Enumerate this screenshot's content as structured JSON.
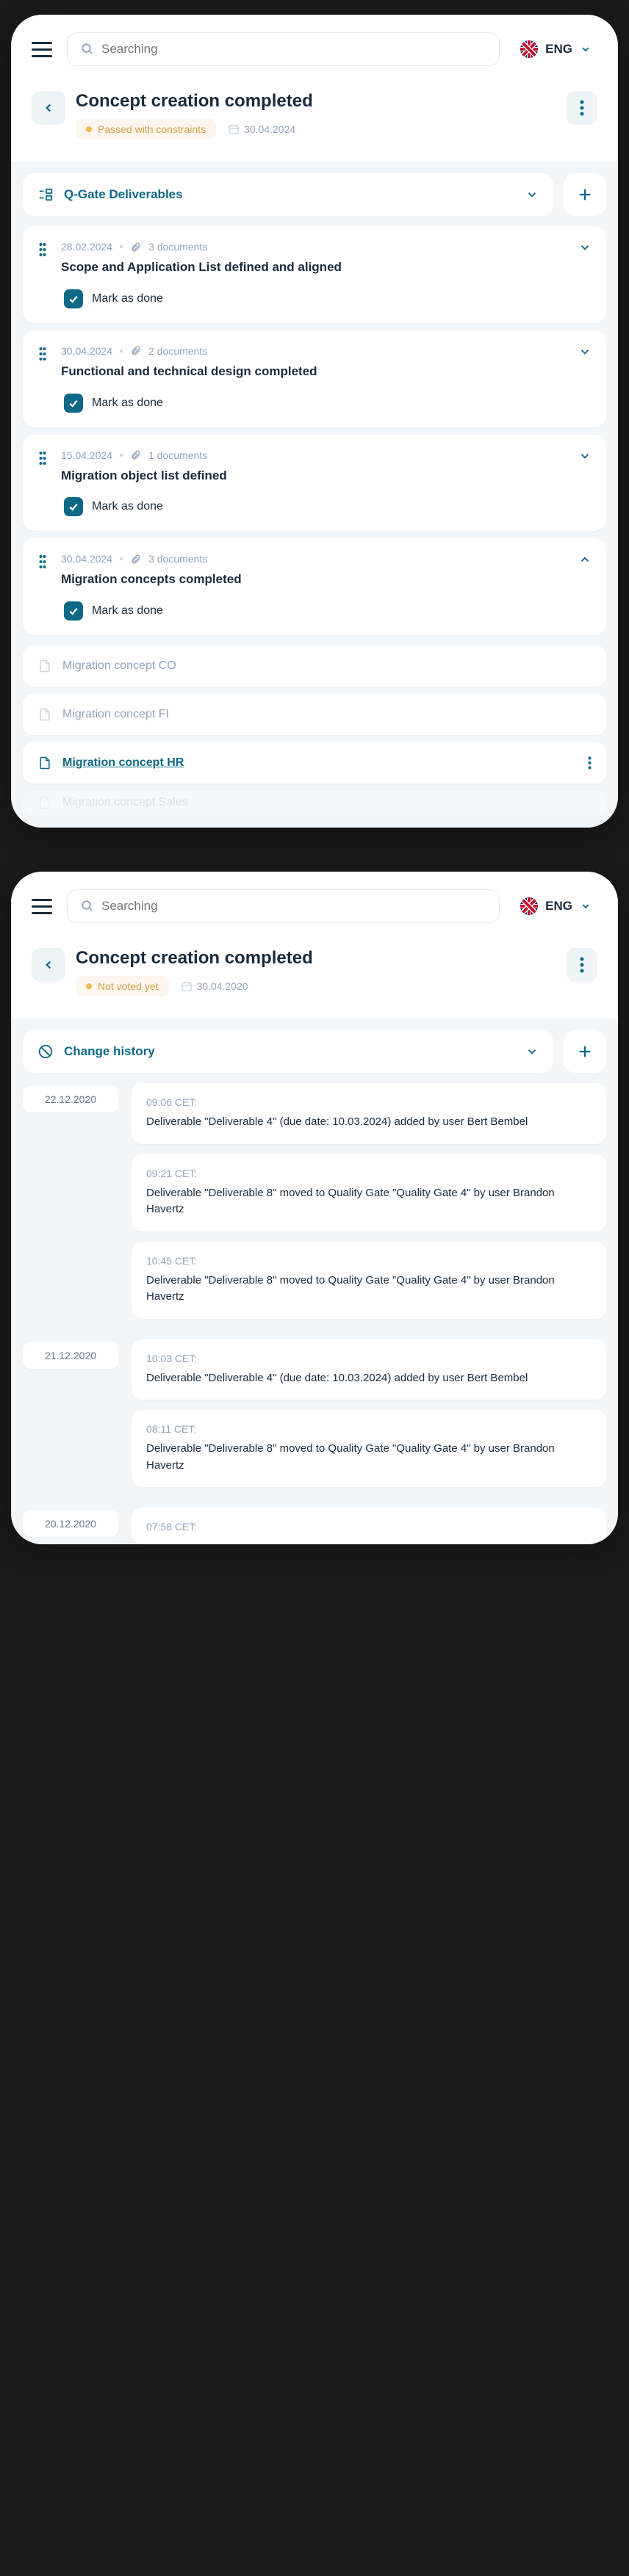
{
  "common": {
    "search_placeholder": "Searching",
    "lang": "ENG",
    "mark_done": "Mark as done"
  },
  "screen1": {
    "title": "Concept creation completed",
    "status": "Passed with constraints",
    "date": "30.04.2024",
    "section_title": "Q-Gate Deliverables",
    "deliverables": [
      {
        "date": "28.02.2024",
        "docs": "3 documents",
        "title": "Scope and Application List defined and aligned",
        "expanded": false
      },
      {
        "date": "30.04.2024",
        "docs": "2 documents",
        "title": "Functional and technical design completed",
        "expanded": false
      },
      {
        "date": "15.04.2024",
        "docs": "1 documents",
        "title": "Migration object list defined",
        "expanded": false
      },
      {
        "date": "30.04.2024",
        "docs": "3 documents",
        "title": "Migration concepts completed",
        "expanded": true
      }
    ],
    "sub_items": [
      {
        "title": "Migration concept CO",
        "active": false
      },
      {
        "title": "Migration concept FI",
        "active": false
      },
      {
        "title": "Migration concept HR",
        "active": true
      },
      {
        "title": "Migration concept Sales",
        "active": false
      }
    ]
  },
  "screen2": {
    "title": "Concept creation completed",
    "status": "Not voted yet",
    "date": "30.04.2020",
    "section_title": "Change history",
    "groups": [
      {
        "date": "22.12.2020",
        "items": [
          {
            "time": "09:06 CET:",
            "text": "Deliverable \"Deliverable 4\" (due date: 10.03.2024) added by user Bert Bembel"
          },
          {
            "time": "09:21 CET:",
            "text": "Deliverable \"Deliverable 8\" moved to Quality Gate \"Quality Gate 4\" by user Brandon Havertz"
          },
          {
            "time": "10:45 CET:",
            "text": "Deliverable \"Deliverable 8\" moved to Quality Gate \"Quality Gate 4\" by user Brandon Havertz"
          }
        ]
      },
      {
        "date": "21.12.2020",
        "items": [
          {
            "time": "10:03 CET:",
            "text": "Deliverable \"Deliverable 4\" (due date: 10.03.2024) added by user Bert Bembel"
          },
          {
            "time": "08:11 CET:",
            "text": "Deliverable \"Deliverable 8\" moved to Quality Gate \"Quality Gate 4\" by user Brandon Havertz"
          }
        ]
      },
      {
        "date": "20.12.2020",
        "items": [
          {
            "time": "07:58 CET:",
            "text": ""
          }
        ]
      }
    ]
  }
}
